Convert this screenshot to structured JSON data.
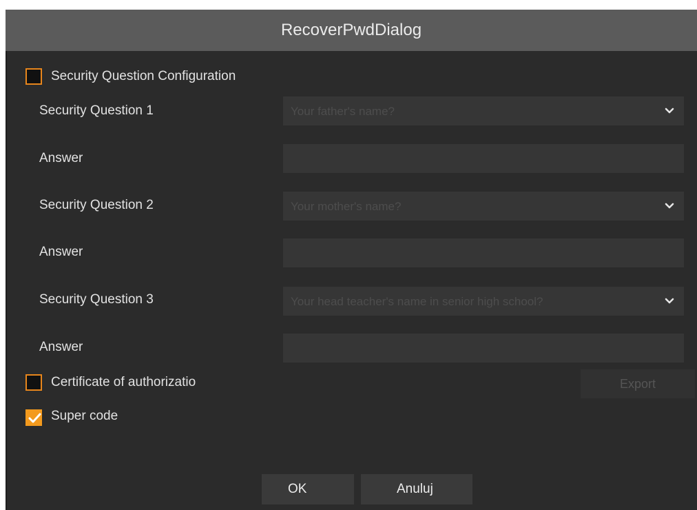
{
  "dialog": {
    "title": "RecoverPwdDialog"
  },
  "security_config": {
    "label": "Security Question Configuration",
    "checked": false
  },
  "questions": [
    {
      "label": "Security Question 1",
      "value": "Your father's name?",
      "answer_label": "Answer",
      "answer_value": ""
    },
    {
      "label": "Security Question 2",
      "value": "Your mother's name?",
      "answer_label": "Answer",
      "answer_value": ""
    },
    {
      "label": "Security Question 3",
      "value": "Your head teacher's name in senior high school?",
      "answer_label": "Answer",
      "answer_value": ""
    }
  ],
  "certificate": {
    "label": "Certificate of authorizatio",
    "checked": false,
    "export_label": "Export"
  },
  "super_code": {
    "label": "Super code",
    "checked": true
  },
  "footer": {
    "ok_label": "OK",
    "cancel_label": "Anuluj"
  },
  "colors": {
    "accent": "#f39a1e",
    "titlebar": "#5b5b5b",
    "background": "#2b2b2b"
  },
  "icons": {
    "dropdown": "chevron-down-icon",
    "check": "checkmark-icon"
  }
}
